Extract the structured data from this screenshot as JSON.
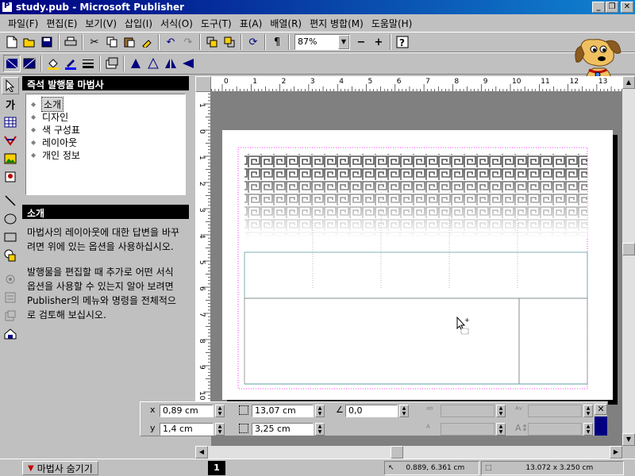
{
  "window": {
    "title": "study.pub - Microsoft Publisher",
    "minimize": "_",
    "restore": "❐",
    "close": "✕"
  },
  "menu": [
    "파일(F)",
    "편집(E)",
    "보기(V)",
    "삽입(I)",
    "서식(O)",
    "도구(T)",
    "표(A)",
    "배열(R)",
    "편지 병합(M)",
    "도움말(H)"
  ],
  "toolbar": {
    "zoom": "87%",
    "zoom_out": "−",
    "zoom_in": "+",
    "pilcrow": "¶"
  },
  "wizard": {
    "title": "즉석 발행물 마법사",
    "items": [
      {
        "label": "소개",
        "selected": true
      },
      {
        "label": "디자인",
        "selected": false
      },
      {
        "label": "색 구성표",
        "selected": false
      },
      {
        "label": "레이아웃",
        "selected": false
      },
      {
        "label": "개인 정보",
        "selected": false
      }
    ],
    "section_title": "소개",
    "text1": "마법사의 레이아웃에 대한 답변을 바꾸려면 위에 있는 옵션을 사용하십시오.",
    "text2": "발행물을 편집할 때 추가로 어떤 서식 옵션을 사용할 수 있는지 알아 보려면 Publisher의 메뉴와 명령을 전체적으로 검토해 보십시오."
  },
  "ruler": {
    "h_labels": [
      "0",
      "1",
      "2",
      "3",
      "4",
      "5",
      "6",
      "7",
      "8",
      "9",
      "10",
      "11",
      "12",
      "13"
    ],
    "v_labels": [
      "1",
      "0",
      "1",
      "2",
      "3",
      "4",
      "5",
      "6",
      "7",
      "8",
      "9",
      "10"
    ]
  },
  "measurements": {
    "x_label": "x",
    "x_value": "0,89 cm",
    "y_label": "y",
    "y_value": "1,4 cm",
    "width_value": "13,07 cm",
    "height_value": "3,25 cm",
    "angle_value": "0,0",
    "close": "✕"
  },
  "status": {
    "hide_wizard": "마법사 숨기기",
    "page": "1",
    "position": "0.889, 6.361 cm",
    "size": "13.072 x  3.250 cm"
  }
}
